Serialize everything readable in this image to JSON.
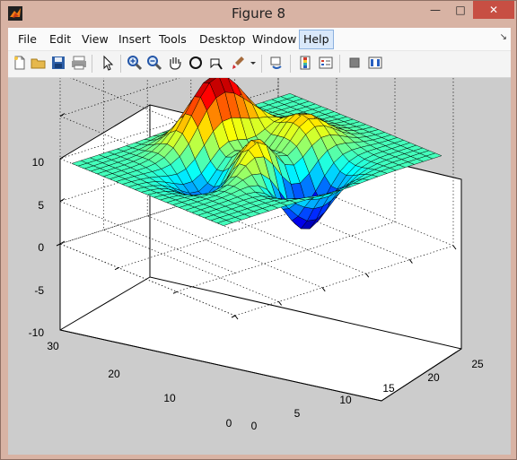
{
  "window": {
    "title": "Figure 8",
    "controls": {
      "minimize": "—",
      "maximize": "□",
      "close": "✕"
    }
  },
  "menu": {
    "items": [
      "File",
      "Edit",
      "View",
      "Insert",
      "Tools",
      "Desktop",
      "Window",
      "Help"
    ],
    "active": "Help",
    "extra": "↘"
  },
  "toolbar": {
    "buttons": [
      "new-figure-icon",
      "open-file-icon",
      "save-icon",
      "print-icon",
      "edit-plot-arrow-icon",
      "zoom-in-icon",
      "zoom-out-icon",
      "pan-hand-icon",
      "rotate-3d-icon",
      "data-cursor-icon",
      "brush-icon",
      "link-plot-icon",
      "colorbar-icon",
      "legend-icon",
      "hide-plot-tools-icon",
      "show-plot-tools-icon"
    ]
  },
  "axes": {
    "z_ticks": [
      "10",
      "5",
      "0",
      "-5",
      "-10"
    ],
    "y_ticks": [
      "30",
      "20",
      "10",
      "0"
    ],
    "x_ticks": [
      "0",
      "5",
      "10",
      "15",
      "20",
      "25"
    ]
  },
  "chart_data": {
    "type": "surface",
    "title": "",
    "xlabel": "",
    "ylabel": "",
    "zlabel": "",
    "xlim": [
      0,
      25
    ],
    "ylim": [
      0,
      30
    ],
    "zlim": [
      -10,
      10
    ],
    "grid": true,
    "colormap": "jet",
    "surface": "peaks",
    "grid_size": [
      25,
      25
    ]
  },
  "colors": {
    "titlebar": "#d8b3a4",
    "close": "#c74f43",
    "canvas": "#cccccc",
    "surface_edge": "#000000"
  }
}
